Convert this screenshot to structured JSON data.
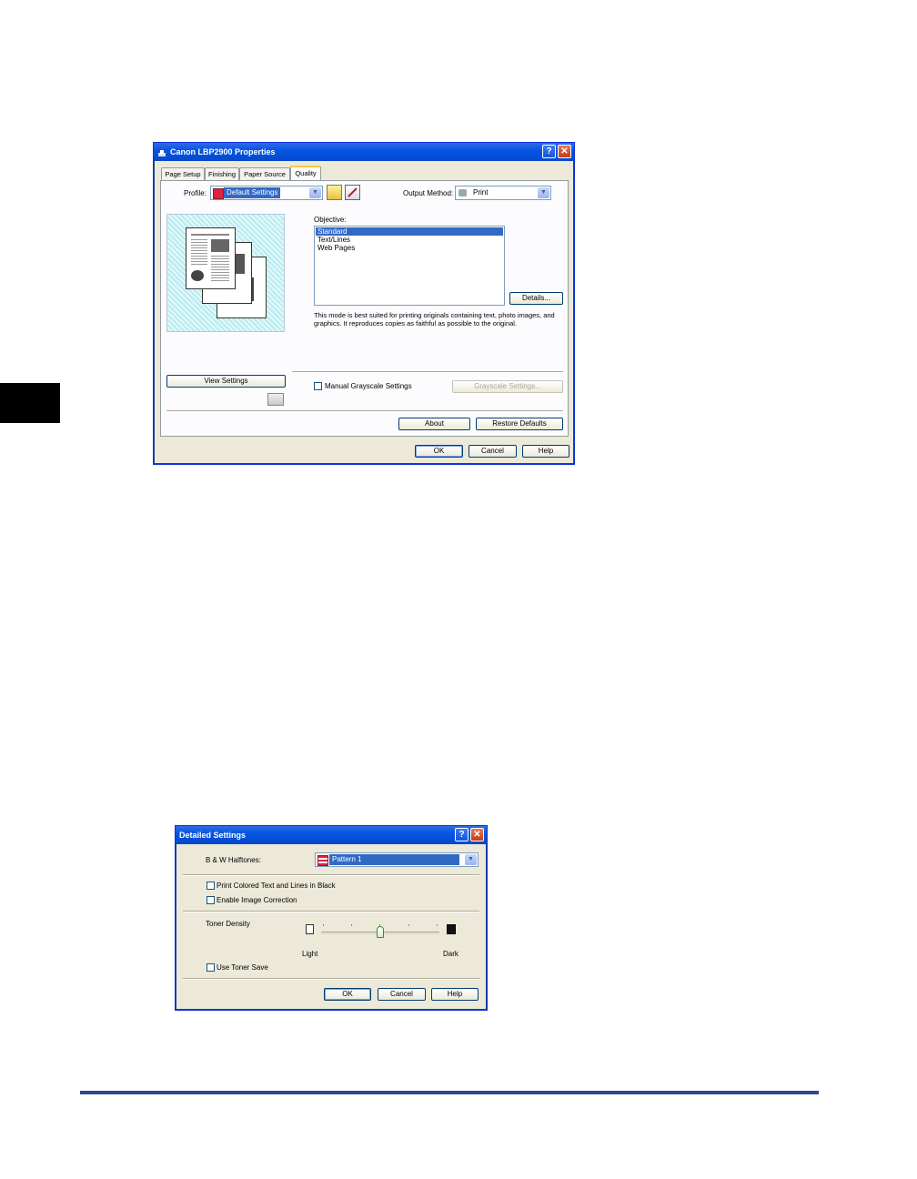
{
  "properties_dialog": {
    "title": "Canon LBP2900 Properties",
    "help_btn": "?",
    "close_btn": "✕",
    "tabs": [
      "Page Setup",
      "Finishing",
      "Paper Source",
      "Quality"
    ],
    "profile_label": "Profile:",
    "profile_value": "Default Settings",
    "output_method_label": "Output Method:",
    "output_method_value": "Print",
    "objective_label": "Objective:",
    "objectives": [
      "Standard",
      "Text/Lines",
      "Web Pages"
    ],
    "details_button": "Details...",
    "description": "This mode is best suited for printing originals containing text, photo images, and graphics. It reproduces copies as faithful as possible to the original.",
    "view_settings_button": "View Settings",
    "manual_grayscale_label": "Manual Grayscale Settings",
    "grayscale_settings_button": "Grayscale Settings...",
    "about_button": "About",
    "restore_defaults_button": "Restore Defaults",
    "ok_button": "OK",
    "cancel_button": "Cancel",
    "help_button": "Help"
  },
  "detailed_dialog": {
    "title": "Detailed Settings",
    "help_btn": "?",
    "close_btn": "✕",
    "halftones_label": "B & W Halftones:",
    "halftones_value": "Pattern 1",
    "print_colored_label": "Print Colored Text and Lines in Black",
    "enable_image_correction_label": "Enable Image Correction",
    "toner_density_label": "Toner Density",
    "toner_density_level": 0.5,
    "light_label": "Light",
    "dark_label": "Dark",
    "use_toner_save_label": "Use Toner Save",
    "ok_button": "OK",
    "cancel_button": "Cancel",
    "help_button": "Help"
  },
  "colors": {
    "titlebar": "#0a53e4",
    "dialog_bg": "#ece9d8",
    "selection": "#316ac5",
    "side_tab": "#000000",
    "bottom_rule": "#2f4692"
  }
}
